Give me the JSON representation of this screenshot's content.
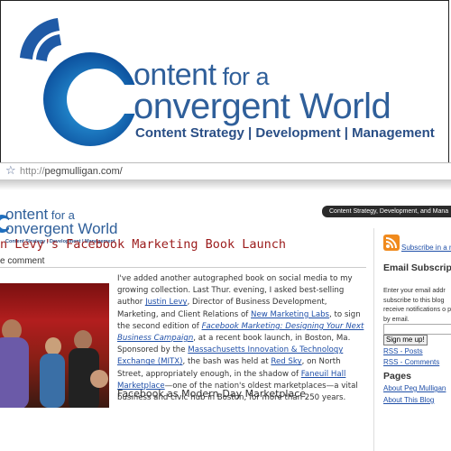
{
  "logo": {
    "line1_big": "ontent",
    "line1_small": " for a",
    "line2": "onvergent World",
    "tagline": "Content Strategy | Development | Management"
  },
  "browser": {
    "url_protocol": "http://",
    "url_host": "pegmulligan.com/"
  },
  "site": {
    "logo_line1_big": "ontent",
    "logo_line1_small": " for a",
    "logo_line2": "onvergent World",
    "logo_tagline": "Content Strategy | Development | Management",
    "nav_text": "Content Strategy, Development, and Mana",
    "post_title": "n Levy's Facebook Marketing Book Launch",
    "comment_link": "e comment",
    "section_heading": "Facebook as Modern-Day Marketplace"
  },
  "post": {
    "t1": "I've added another autographed book on social media to my growing collection. Last Thur. evening, I asked best-selling author ",
    "l1": "Justin Levy",
    "t2": ", Director of Business Development, Marketing, and Client Relations of ",
    "l2": "New Marketing Labs",
    "t3": ", to sign the second edition of ",
    "l3": "Facebook Marketing: Designing Your Next Business Campaign",
    "t4": ", at a recent book launch, in Boston, Ma. Sponsored by the ",
    "l4": "Massachusetts Innovation & Technology Exchange (MITX)",
    "t5": ", the bash was held at ",
    "l5": "Red Sky",
    "t6": ", on North Street, appropriately enough, in the shadow of ",
    "l6": "Faneuil Hall Marketplace",
    "t7": "—one of the nation's oldest marketplaces—a vital business and civic hub in Boston, for more than 250 years."
  },
  "sidebar": {
    "rss_link": "Subscribe in a r",
    "email_heading": "Email Subscripti",
    "email_text": "Enter your email addr subscribe to this blog receive notifications o posts by email.",
    "signup_button": "Sign me up!",
    "rss_posts": "RSS - Posts",
    "rss_comments": "RSS - Comments",
    "pages_heading": "Pages",
    "page1": "About Peg Mulligan",
    "page2": "About This Blog"
  },
  "colors": {
    "brand_blue": "#2f5f9a",
    "title_red": "#9b1b1b",
    "link_blue": "#1f4fa8",
    "rss_orange": "#f08a1d"
  }
}
